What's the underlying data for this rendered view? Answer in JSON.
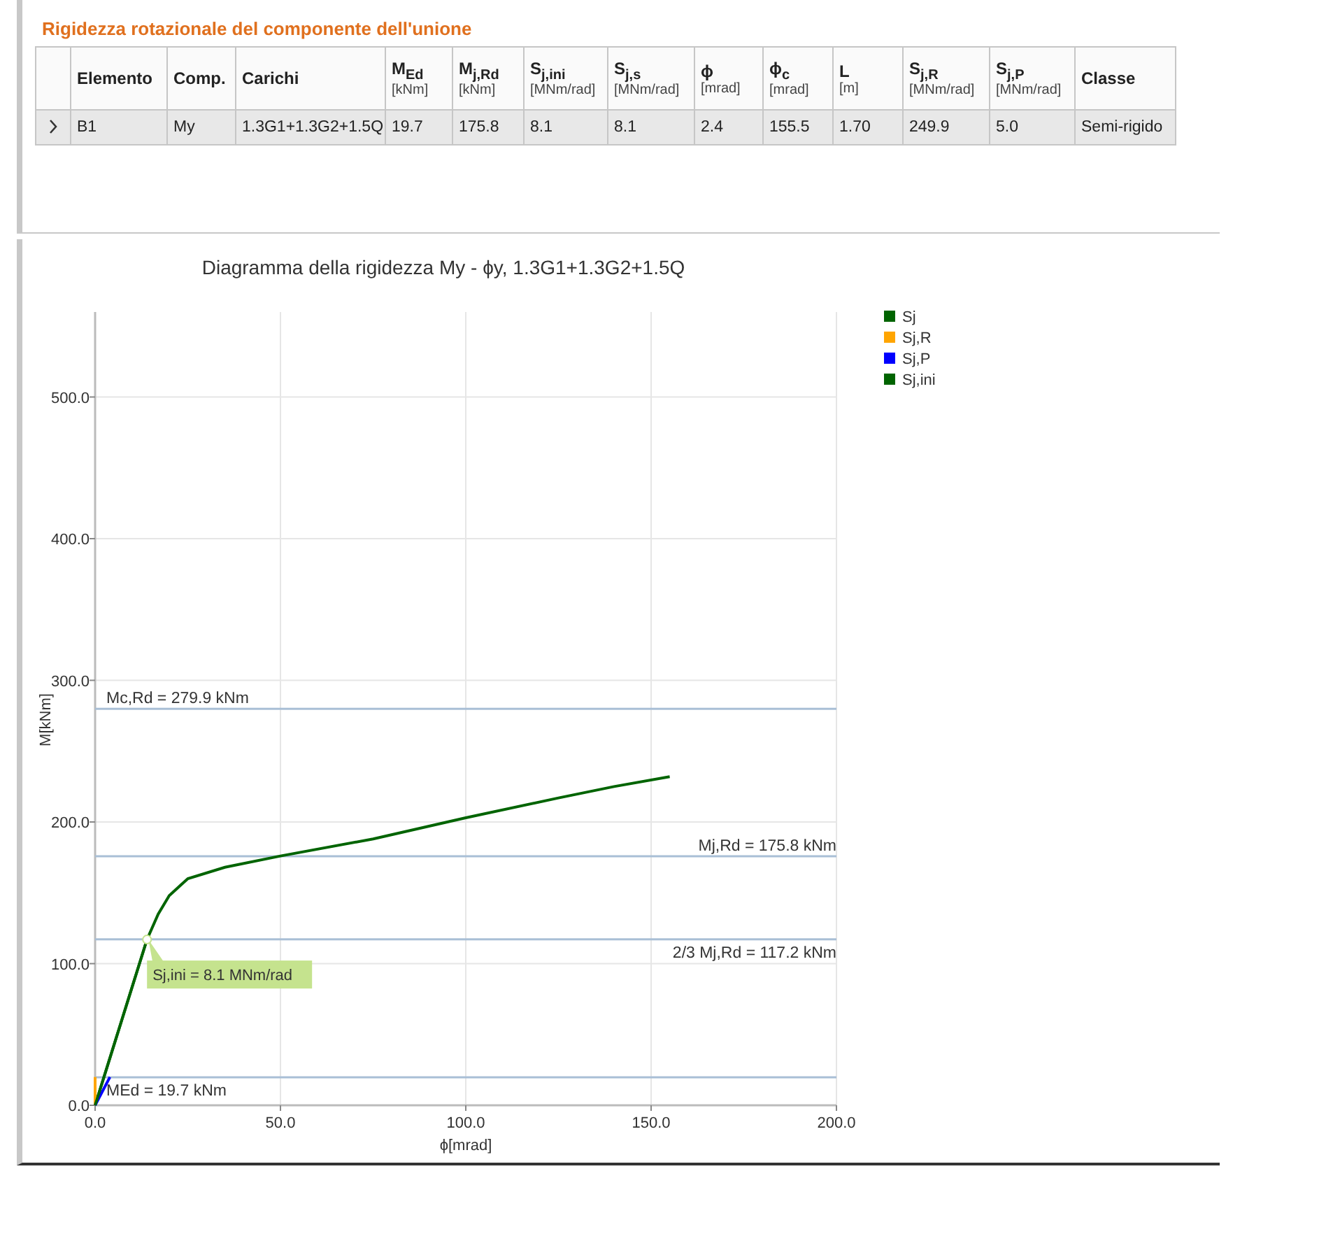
{
  "section_title": "Rigidezza rotazionale del componente dell'unione",
  "table": {
    "columns": [
      {
        "label": "Elemento"
      },
      {
        "label": "Comp."
      },
      {
        "label": "Carichi"
      },
      {
        "label": "M$_{Ed}$",
        "unit": "[kNm]"
      },
      {
        "label": "M$_{j,Rd}$",
        "unit": "[kNm]"
      },
      {
        "label": "S$_{j,ini}$",
        "unit": "[MNm/rad]"
      },
      {
        "label": "S$_{j,s}$",
        "unit": "[MNm/rad]"
      },
      {
        "label": "ϕ",
        "unit": "[mrad]"
      },
      {
        "label": "ϕ$_{c}$",
        "unit": "[mrad]"
      },
      {
        "label": "L",
        "unit": "[m]"
      },
      {
        "label": "S$_{j,R}$",
        "unit": "[MNm/rad]"
      },
      {
        "label": "S$_{j,P}$",
        "unit": "[MNm/rad]"
      },
      {
        "label": "Classe"
      }
    ],
    "rows": [
      {
        "expanded": false,
        "cells": [
          "B1",
          "My",
          "1.3G1+1.3G2+1.5Q",
          "19.7",
          "175.8",
          "8.1",
          "8.1",
          "2.4",
          "155.5",
          "1.70",
          "249.9",
          "5.0",
          "Semi-rigido"
        ]
      }
    ]
  },
  "chart_data": {
    "type": "line",
    "title": "Diagramma della rigidezza My - ϕy, 1.3G1+1.3G2+1.5Q",
    "xlabel": "ϕ[mrad]",
    "ylabel": "M[kNm]",
    "xlim": [
      0,
      200
    ],
    "ylim": [
      0,
      560
    ],
    "xticks": [
      {
        "value": 0,
        "label": "0.0"
      },
      {
        "value": 50,
        "label": "50.0"
      },
      {
        "value": 100,
        "label": "100.0"
      },
      {
        "value": 150,
        "label": "150.0"
      },
      {
        "value": 200,
        "label": "200.0"
      }
    ],
    "yticks": [
      {
        "value": 0,
        "label": "0.0"
      },
      {
        "value": 100,
        "label": "100.0"
      },
      {
        "value": 200,
        "label": "200.0"
      },
      {
        "value": 300,
        "label": "300.0"
      },
      {
        "value": 400,
        "label": "400.0"
      },
      {
        "value": 500,
        "label": "500.0"
      }
    ],
    "series": [
      {
        "name": "Sj",
        "color": "#006400",
        "x": [
          0,
          14,
          17,
          20,
          25,
          35,
          50,
          75,
          100,
          125,
          140,
          155
        ],
        "values": [
          0,
          117,
          135,
          148,
          160,
          168,
          176,
          188,
          203,
          217,
          225,
          232
        ]
      },
      {
        "name": "Sj,R",
        "color": "#ffa500",
        "x": [
          0,
          0
        ],
        "values": [
          0,
          20
        ]
      },
      {
        "name": "Sj,P",
        "color": "#0000ff",
        "x": [
          0,
          4
        ],
        "values": [
          0,
          20
        ]
      },
      {
        "name": "Sj,ini",
        "color": "#006400",
        "x": [
          0,
          14
        ],
        "values": [
          0,
          117
        ]
      }
    ],
    "grid": true,
    "legend": true,
    "ref_lines": [
      {
        "axis": "y",
        "value": 279.9,
        "label": "Mc,Rd = 279.9 kNm"
      },
      {
        "axis": "y",
        "value": 175.8,
        "label": "Mj,Rd = 175.8 kNm"
      },
      {
        "axis": "y",
        "value": 117.2,
        "label": "2/3 Mj,Rd = 117.2 kNm"
      },
      {
        "axis": "y",
        "value": 19.7,
        "label": "MEd = 19.7 kNm"
      }
    ],
    "annotations": [
      "Sj,ini = 8.1 MNm/rad"
    ]
  }
}
